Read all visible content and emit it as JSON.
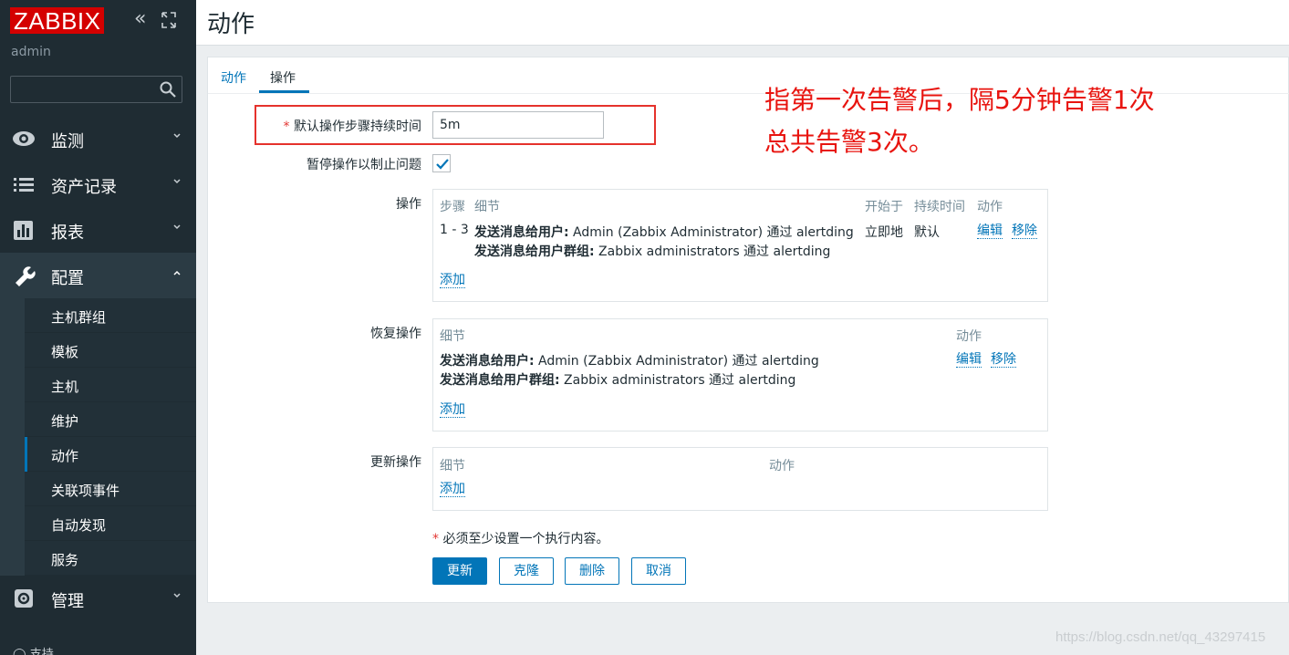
{
  "sidebar": {
    "logo": "ZABBIX",
    "user": "admin",
    "search_placeholder": "",
    "menu": [
      {
        "label": "监测",
        "icon": "eye-icon"
      },
      {
        "label": "资产记录",
        "icon": "list-icon"
      },
      {
        "label": "报表",
        "icon": "bar-chart-icon"
      },
      {
        "label": "配置",
        "icon": "wrench-icon"
      }
    ],
    "submenu": [
      "主机群组",
      "模板",
      "主机",
      "维护",
      "动作",
      "关联项事件",
      "自动发现",
      "服务"
    ],
    "admin_label": "管理",
    "bottom_partial": "支持"
  },
  "header": {
    "title": "动作"
  },
  "tabs": [
    "动作",
    "操作"
  ],
  "form": {
    "duration_label": "默认操作步骤持续时间",
    "duration_value": "5m",
    "pause_label": "暂停操作以制止问题",
    "pause_checked": true,
    "operations_label": "操作",
    "recovery_label": "恢复操作",
    "update_label": "更新操作"
  },
  "operations": {
    "headers": [
      "步骤",
      "细节",
      "开始于",
      "持续时间",
      "动作"
    ],
    "row": {
      "steps": "1 - 3",
      "detail1_bold": "发送消息给用户:",
      "detail1_rest": " Admin (Zabbix Administrator) 通过 alertding",
      "detail2_bold": "发送消息给用户群组:",
      "detail2_rest": " Zabbix administrators 通过 alertding",
      "start": "立即地",
      "duration": "默认",
      "edit": "编辑",
      "remove": "移除"
    },
    "add": "添加"
  },
  "recovery": {
    "headers": [
      "细节",
      "动作"
    ],
    "detail1_bold": "发送消息给用户:",
    "detail1_rest": " Admin (Zabbix Administrator) 通过 alertding",
    "detail2_bold": "发送消息给用户群组:",
    "detail2_rest": " Zabbix administrators 通过 alertding",
    "edit": "编辑",
    "remove": "移除",
    "add": "添加"
  },
  "update_ops": {
    "headers": [
      "细节",
      "动作"
    ],
    "add": "添加"
  },
  "note": "必须至少设置一个执行内容。",
  "buttons": {
    "update": "更新",
    "clone": "克隆",
    "delete": "删除",
    "cancel": "取消"
  },
  "annotation": {
    "line1": "指第一次告警后，隔5分钟告警1次",
    "line2": "总共告警3次。"
  },
  "watermark": "https://blog.csdn.net/qq_43297415",
  "colors": {
    "sidebar": "#1f2c33",
    "accent": "#0275b8",
    "logo_red": "#d40000",
    "annotation_red": "#e8140f"
  }
}
